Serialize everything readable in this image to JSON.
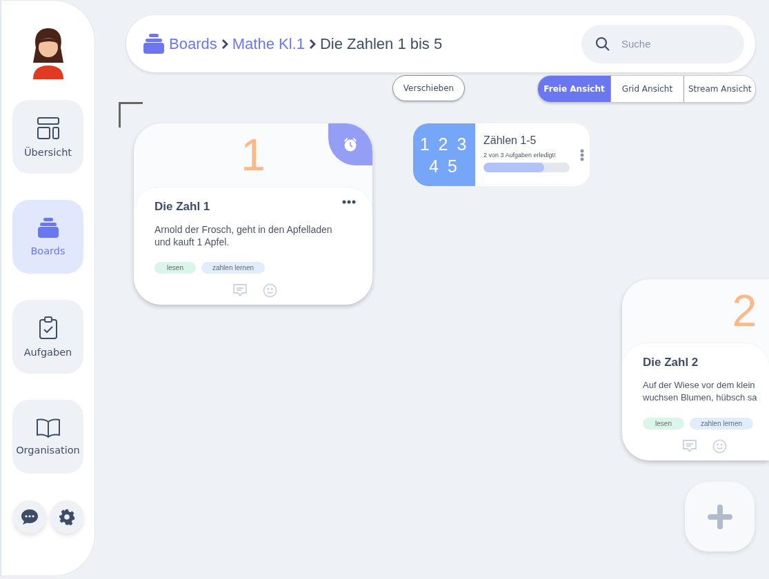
{
  "breadcrumb": [
    {
      "label": "Boards",
      "kind": "link"
    },
    {
      "label": "Mathe Kl.1",
      "kind": "link"
    },
    {
      "label": "Die Zahlen 1 bis 5",
      "kind": "current"
    }
  ],
  "search": {
    "placeholder": "Suche"
  },
  "sidebar": {
    "items": [
      {
        "label": "Übersicht",
        "selected": false
      },
      {
        "label": "Boards",
        "selected": true
      },
      {
        "label": "Aufgaben",
        "selected": false
      },
      {
        "label": "Organisation",
        "selected": false
      }
    ]
  },
  "toolbar": {
    "move_button": "Verschieben",
    "views": [
      {
        "label": "Freie Ansicht",
        "selected": true
      },
      {
        "label": "Grid Ansicht",
        "selected": false
      },
      {
        "label": "Stream Ansicht",
        "selected": false
      }
    ]
  },
  "cards": [
    {
      "number": "1",
      "title": "Die Zahl 1",
      "text": "Arnold der Frosch, geht in den Apfelladen\nund kauft 1 Apfel.",
      "alarm": true,
      "menu": true,
      "tags": [
        {
          "label": "lesen",
          "color": "#dcf5ea"
        },
        {
          "label": "zahlen lernen",
          "color": "#e1edfd"
        }
      ]
    },
    {
      "number": "2",
      "title": "Die Zahl 2",
      "text": "Auf der Wiese vor dem klein\nwuchsen Blumen, hübsch sa",
      "alarm": false,
      "menu": false,
      "tags": [
        {
          "label": "lesen",
          "color": "#dcf5ea"
        },
        {
          "label": "zahlen lernen",
          "color": "#e1edfd"
        }
      ]
    }
  ],
  "task_card": {
    "thumb_lines": [
      "1 2 3",
      "4 5"
    ],
    "title": "Zählen 1-5",
    "status": "2 von 3 Aufgaben erledigt!",
    "level": 0.7
  }
}
